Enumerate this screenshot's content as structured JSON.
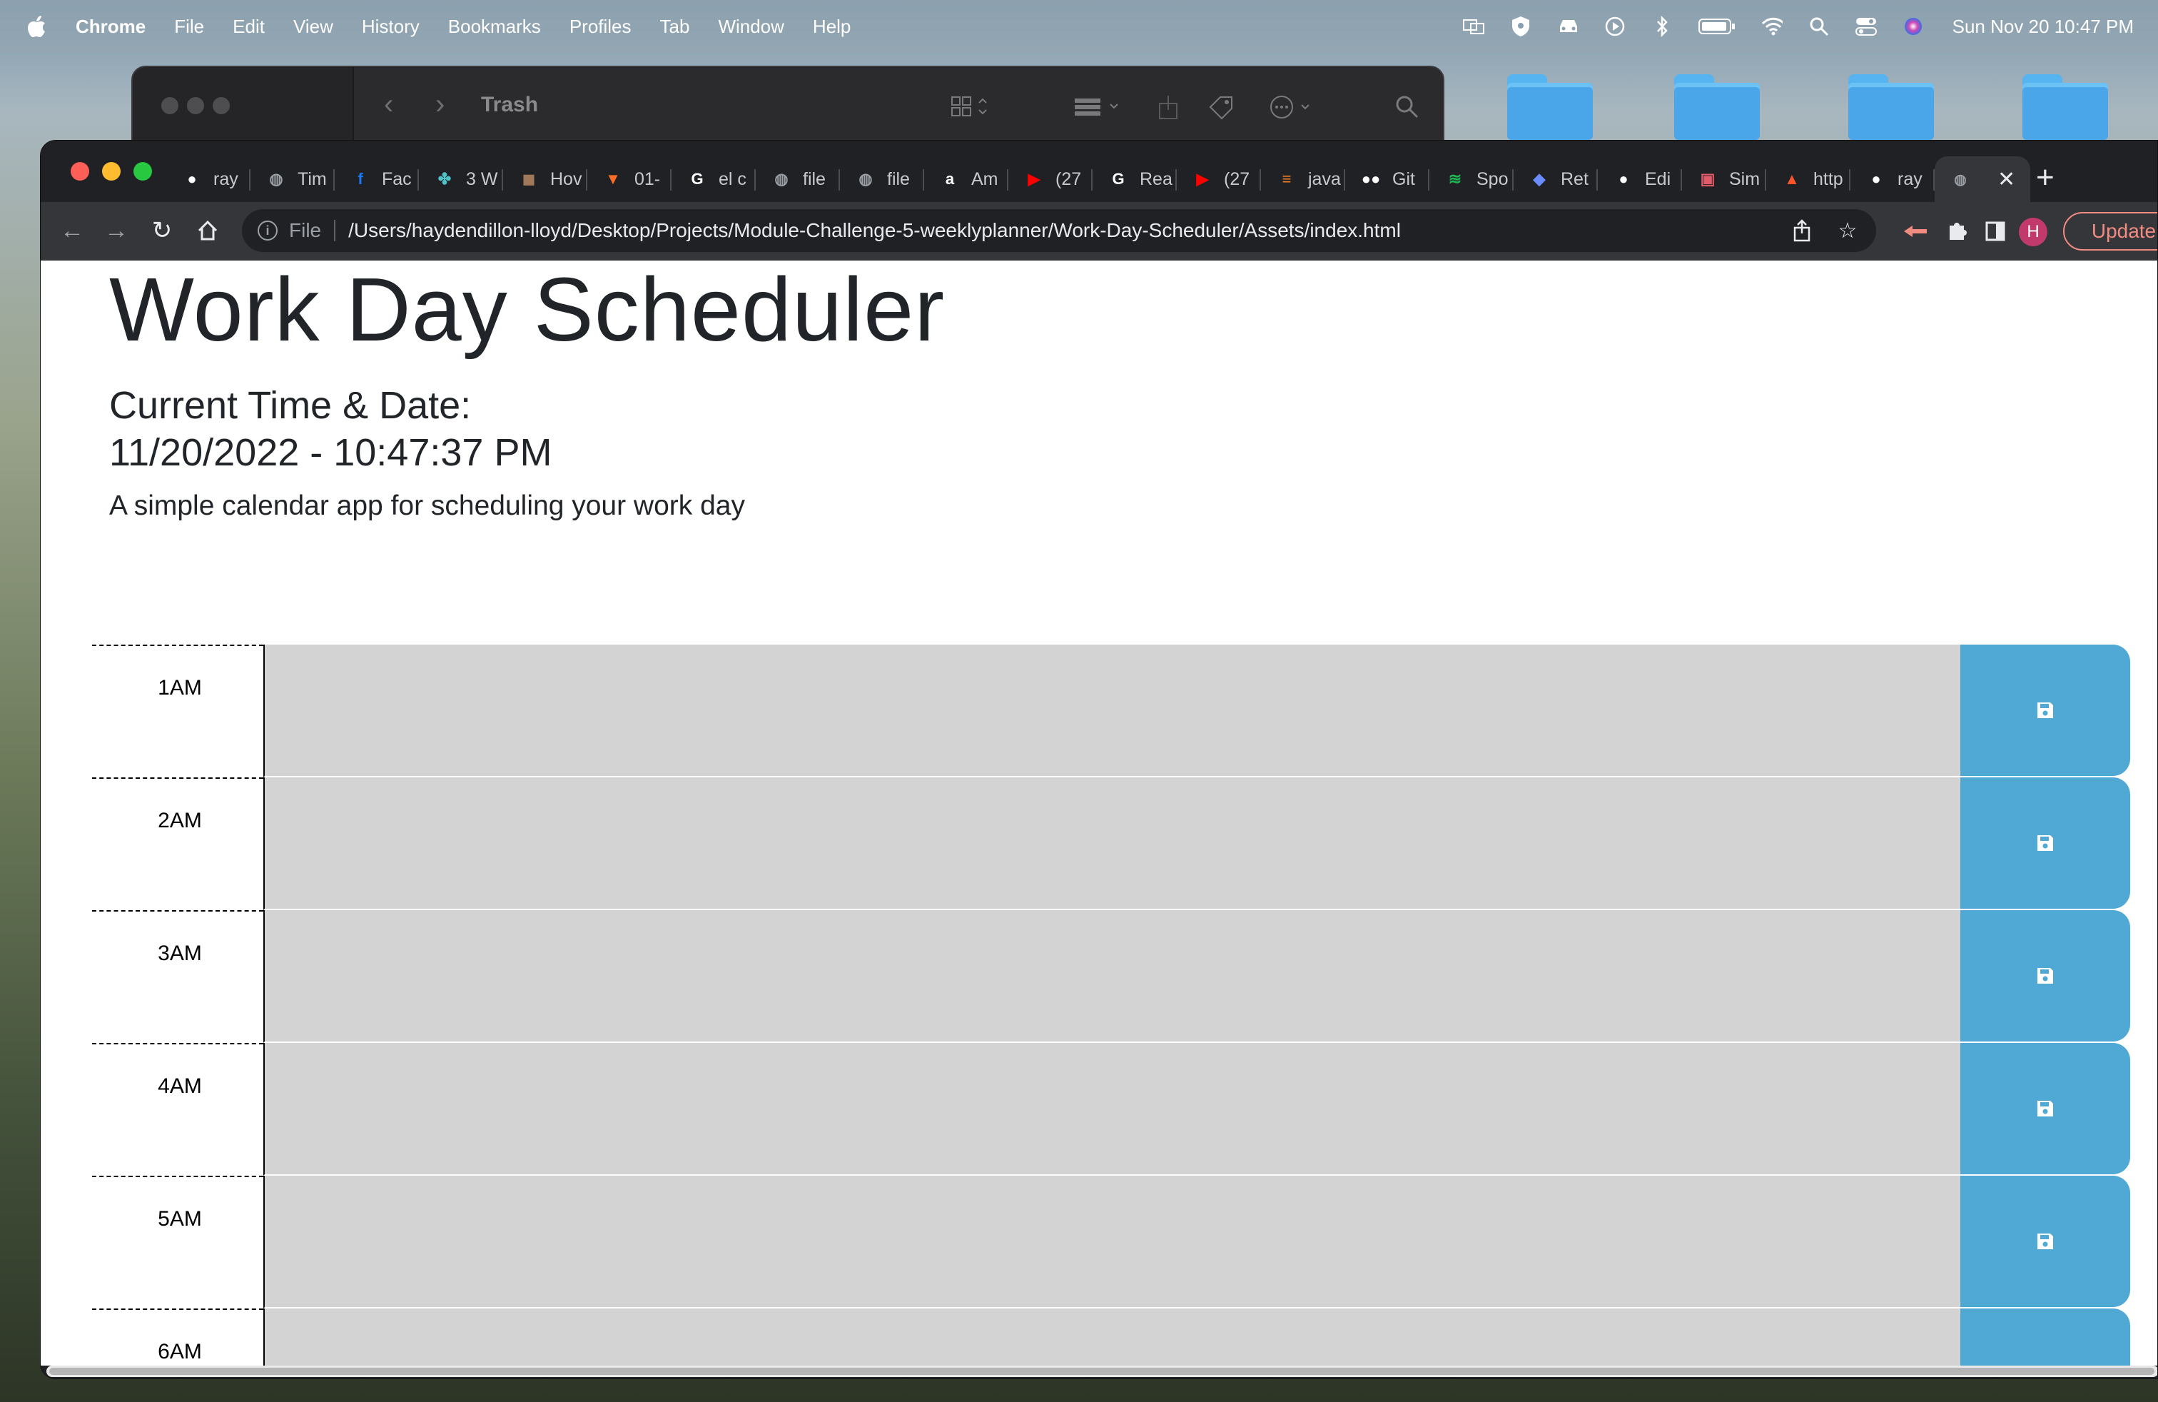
{
  "menubar": {
    "app": "Chrome",
    "items": [
      "File",
      "Edit",
      "View",
      "History",
      "Bookmarks",
      "Profiles",
      "Tab",
      "Window",
      "Help"
    ],
    "clock": "Sun Nov 20  10:47 PM"
  },
  "finder": {
    "title": "Trash"
  },
  "chrome": {
    "tabs": [
      {
        "label": "ray",
        "icon": "github-icon",
        "color": "#ffffff"
      },
      {
        "label": "Tim",
        "icon": "globe-icon",
        "color": "#9aa0a6"
      },
      {
        "label": "Fac",
        "icon": "facebook-icon",
        "color": "#1877f2"
      },
      {
        "label": "3 W",
        "icon": "people-icon",
        "color": "#4fc3c8"
      },
      {
        "label": "Hov",
        "icon": "avatar-icon",
        "color": "#a0785a"
      },
      {
        "label": "01-",
        "icon": "gitlab-icon",
        "color": "#fc6d26"
      },
      {
        "label": "el c",
        "icon": "google-icon",
        "color": "#ffffff"
      },
      {
        "label": "file",
        "icon": "globe-icon",
        "color": "#9aa0a6"
      },
      {
        "label": "file",
        "icon": "globe-icon",
        "color": "#9aa0a6"
      },
      {
        "label": "Am",
        "icon": "amazon-icon",
        "color": "#ffffff"
      },
      {
        "label": "(27",
        "icon": "youtube-icon",
        "color": "#ff0000"
      },
      {
        "label": "Rea",
        "icon": "google-icon",
        "color": "#ffffff"
      },
      {
        "label": "(27",
        "icon": "youtube-icon",
        "color": "#ff0000"
      },
      {
        "label": "java",
        "icon": "stackoverflow-icon",
        "color": "#f48024"
      },
      {
        "label": "Git",
        "icon": "medium-icon",
        "color": "#ffffff"
      },
      {
        "label": "Spo",
        "icon": "spotify-icon",
        "color": "#1db954"
      },
      {
        "label": "Ret",
        "icon": "shield-icon",
        "color": "#6b8cff"
      },
      {
        "label": "Edi",
        "icon": "github-icon",
        "color": "#ffffff"
      },
      {
        "label": "Sim",
        "icon": "box-icon",
        "color": "#e05a6a"
      },
      {
        "label": "http",
        "icon": "brave-icon",
        "color": "#fb542b"
      },
      {
        "label": "ray",
        "icon": "github-icon",
        "color": "#ffffff"
      }
    ],
    "active_tab_close": "✕",
    "new_tab": "+",
    "omnibox": {
      "scheme": "File",
      "url": "/Users/haydendillon-lloyd/Desktop/Projects/Module-Challenge-5-weeklyplanner/Work-Day-Scheduler/Assets/index.html"
    },
    "avatar_letter": "H",
    "update_label": "Update"
  },
  "page": {
    "title": "Work Day Scheduler",
    "time_label": "Current Time & Date:",
    "time_value": "11/20/2022 - 10:47:37 PM",
    "lead": "A simple calendar app for scheduling your work day",
    "hours": [
      {
        "label": "1AM",
        "text": ""
      },
      {
        "label": "2AM",
        "text": ""
      },
      {
        "label": "3AM",
        "text": ""
      },
      {
        "label": "4AM",
        "text": ""
      },
      {
        "label": "5AM",
        "text": ""
      },
      {
        "label": "6AM",
        "text": ""
      }
    ],
    "colors": {
      "past": "#d3d3d3",
      "save_button": "#4fa9d4"
    }
  }
}
